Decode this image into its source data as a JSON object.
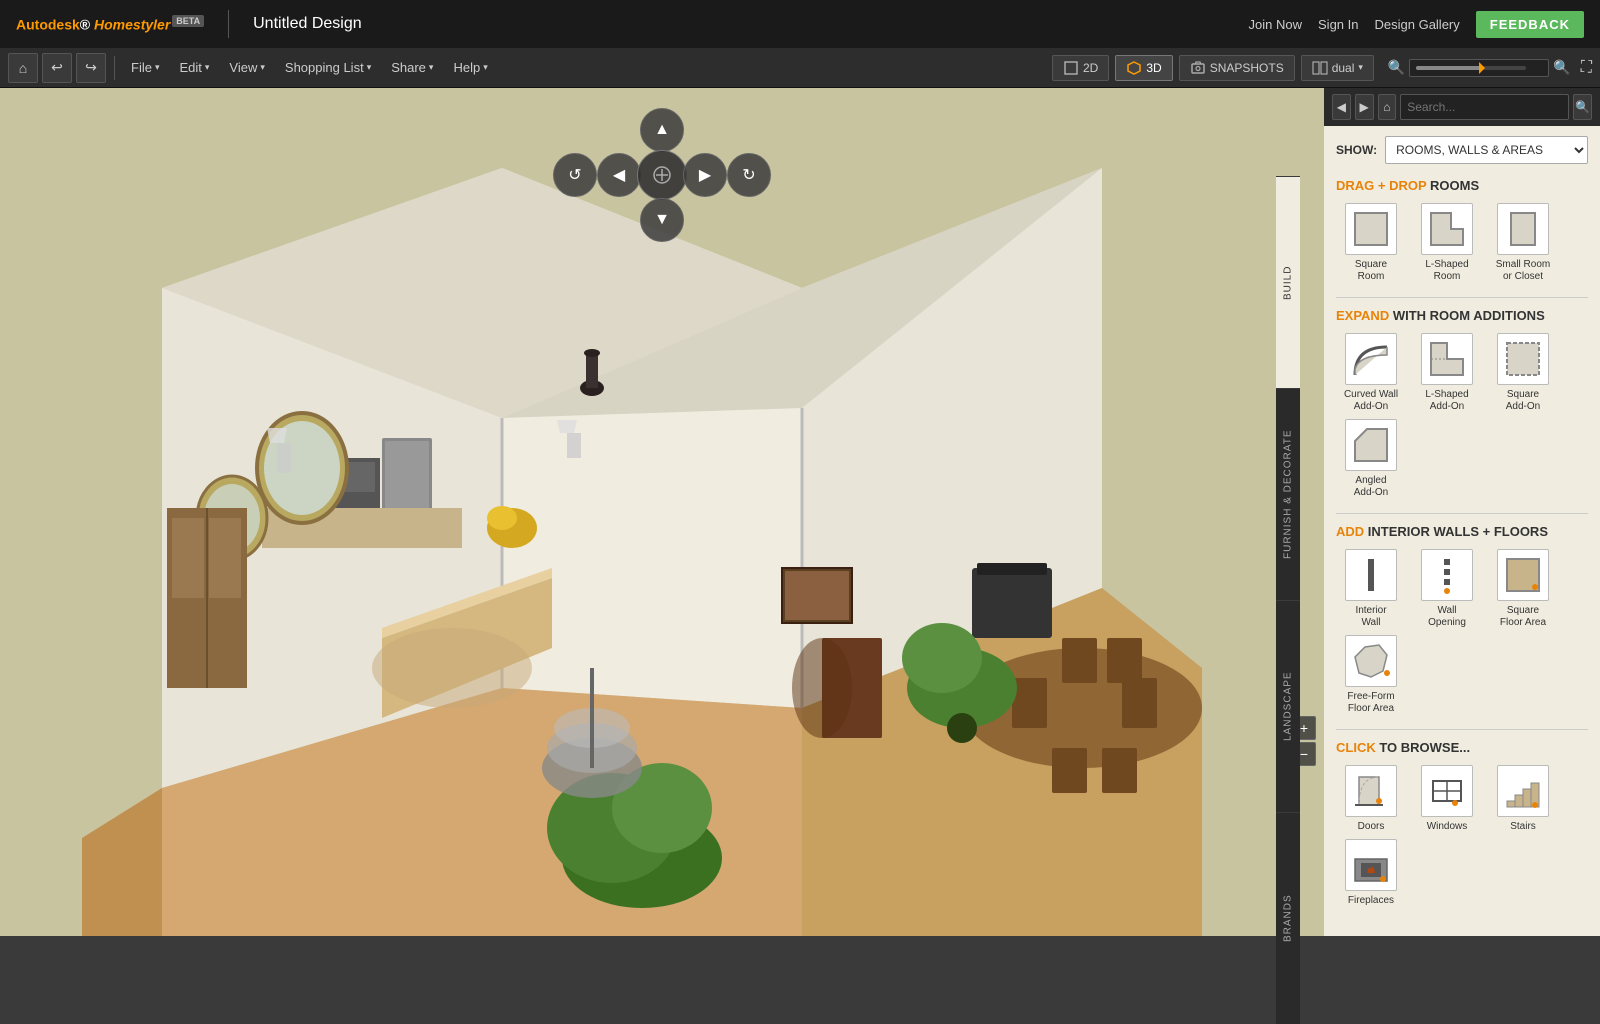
{
  "app": {
    "name": "Autodesk",
    "product": "Homestyler",
    "beta": "BETA",
    "title": "Untitled Design"
  },
  "topbar": {
    "join_now": "Join Now",
    "sign_in": "Sign In",
    "design_gallery": "Design Gallery",
    "feedback": "FEEDBACK"
  },
  "toolbar": {
    "file": "File",
    "edit": "Edit",
    "view": "View",
    "shopping_list": "Shopping List",
    "share": "Share",
    "help": "Help",
    "btn_2d": "2D",
    "btn_3d": "3D",
    "snapshots": "SNAPSHOTS",
    "dual": "dual"
  },
  "panel": {
    "show_label": "SHOW:",
    "show_value": "ROOMS, WALLS & AREAS",
    "build_label": "BUILD",
    "furnish_label": "FURNISH & DECORATE",
    "landscape_label": "LANDSCAPE",
    "brands_label": "BRANDS",
    "sections": {
      "drag_drop": {
        "prefix": "DRAG + DROP",
        "rest": " ROOMS"
      },
      "expand": {
        "prefix": "EXPAND",
        "rest": " WITH ROOM ADDITIONS"
      },
      "add_interior": {
        "prefix": "ADD",
        "rest": " INTERIOR WALLS + FLOORS"
      },
      "click_browse": {
        "prefix": "CLICK",
        "rest": " TO BROWSE..."
      }
    },
    "rooms": [
      {
        "id": "square-room",
        "label": "Square\nRoom",
        "shape": "square"
      },
      {
        "id": "l-shaped-room",
        "label": "L-Shaped\nRoom",
        "shape": "l-shaped"
      },
      {
        "id": "small-room-closet",
        "label": "Small Room\nor Closet",
        "shape": "small-rect"
      }
    ],
    "additions": [
      {
        "id": "curved-wall",
        "label": "Curved Wall\nAdd-On",
        "shape": "curved-wall"
      },
      {
        "id": "l-shaped-addon",
        "label": "L-Shaped\nAdd-On",
        "shape": "l-addon"
      },
      {
        "id": "square-addon",
        "label": "Square\nAdd-On",
        "shape": "square-addon"
      },
      {
        "id": "angled-addon",
        "label": "Angled\nAdd-On",
        "shape": "angled-addon"
      }
    ],
    "walls_floors": [
      {
        "id": "interior-wall",
        "label": "Interior\nWall",
        "shape": "interior-wall"
      },
      {
        "id": "wall-opening",
        "label": "Wall\nOpening",
        "shape": "wall-opening"
      },
      {
        "id": "square-floor",
        "label": "Square\nFloor Area",
        "shape": "square-floor"
      },
      {
        "id": "freeform-floor",
        "label": "Free-Form\nFloor Area",
        "shape": "freeform-floor"
      }
    ],
    "browse": [
      {
        "id": "doors",
        "label": "Doors",
        "shape": "door"
      },
      {
        "id": "windows",
        "label": "Windows",
        "shape": "window"
      },
      {
        "id": "stairs",
        "label": "Stairs",
        "shape": "stairs"
      },
      {
        "id": "fireplaces",
        "label": "Fireplaces",
        "shape": "fireplace"
      }
    ]
  },
  "nav": {
    "rotate_left": "◀",
    "rotate_up": "▲",
    "rotate_right": "▶",
    "rotate_down": "▼"
  }
}
